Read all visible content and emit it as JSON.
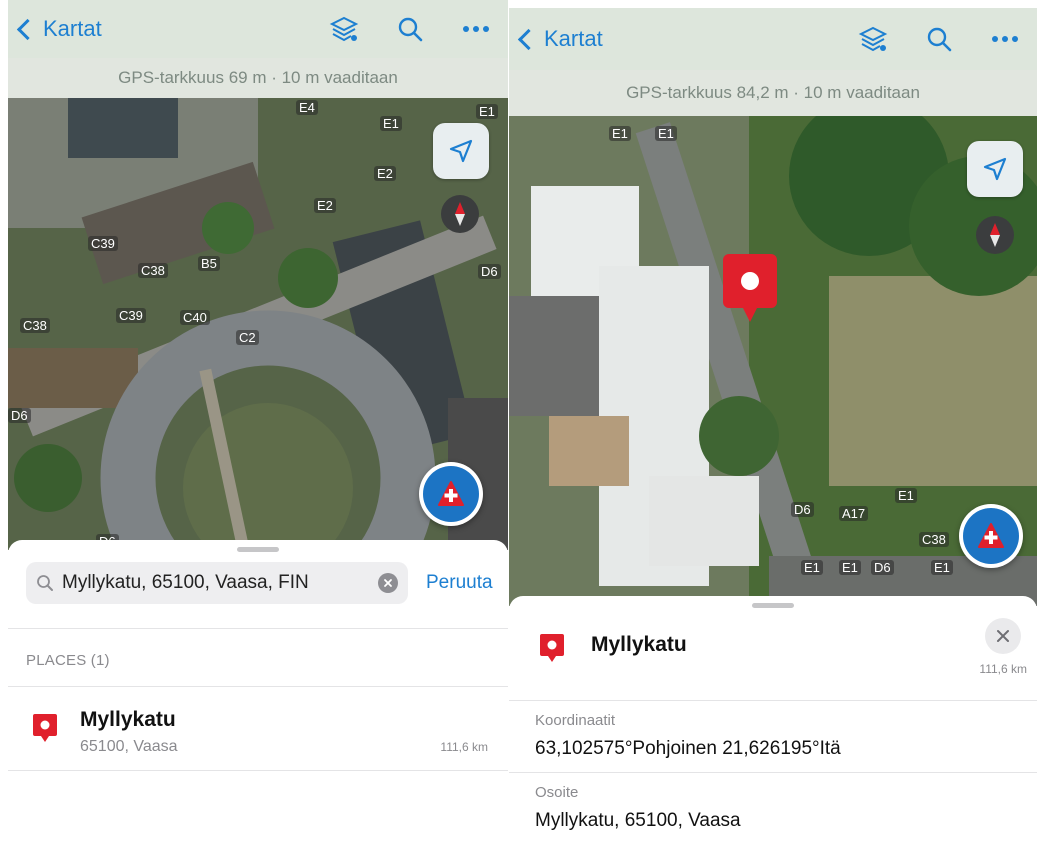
{
  "left": {
    "nav": {
      "back_label": "Kartat"
    },
    "gps": {
      "text": "GPS-tarkkuus 69 m · 10 m vaaditaan"
    },
    "search": {
      "query": "Myllykatu, 65100, Vaasa, FIN",
      "cancel_label": "Peruuta"
    },
    "section_label": "PLACES (1)",
    "result": {
      "title": "Myllykatu",
      "subtitle": "65100, Vaasa",
      "distance": "111,6 km"
    },
    "map_labels": [
      "C39",
      "C38",
      "B5",
      "C39",
      "C40",
      "C38",
      "C2",
      "D6",
      "D6",
      "E2",
      "E2",
      "E1",
      "E1",
      "E4",
      "D6"
    ]
  },
  "right": {
    "nav": {
      "back_label": "Kartat"
    },
    "gps": {
      "text": "GPS-tarkkuus 84,2 m · 10 m vaaditaan"
    },
    "detail": {
      "title": "Myllykatu",
      "distance": "111,6 km",
      "coord_label": "Koordinaatit",
      "coord_value": "63,102575°Pohjoinen  21,626195°Itä",
      "address_label": "Osoite",
      "address_value": "Myllykatu, 65100, Vaasa"
    },
    "map_labels": [
      "E1",
      "E1",
      "D6",
      "A17",
      "E1",
      "C38",
      "E1",
      "E1",
      "D6",
      "E1"
    ]
  },
  "icons": {
    "layers": "layers-icon",
    "search": "search-icon",
    "more": "more-icon",
    "locate": "location-arrow-icon",
    "compass": "compass-icon",
    "add": "add-point-icon",
    "pin": "map-pin-icon",
    "close": "close-icon",
    "clear": "clear-icon"
  },
  "colors": {
    "accent": "#1d7fd1",
    "pin": "#e0202c",
    "fab": "#1c74c4"
  }
}
